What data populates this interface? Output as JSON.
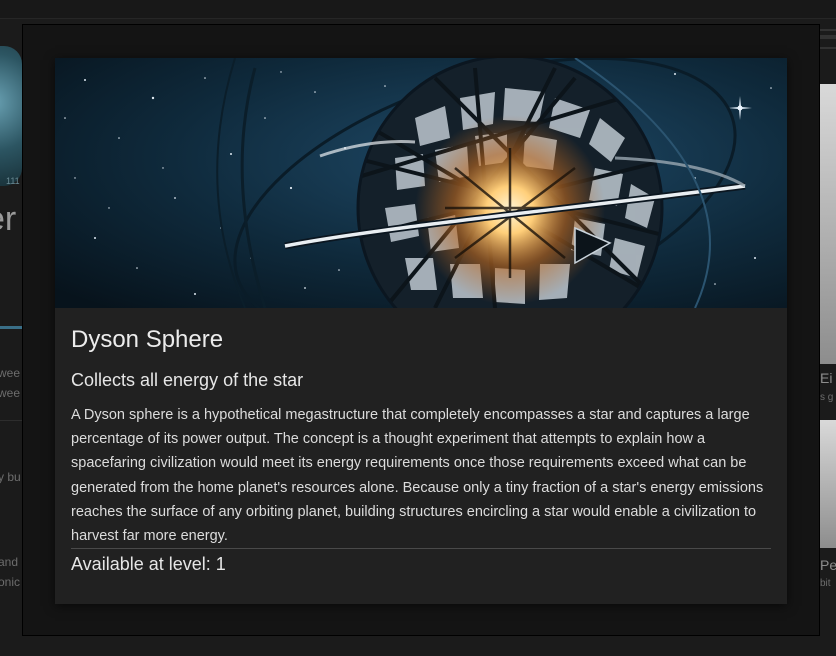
{
  "background": {
    "left_title_fragment": "er",
    "left_texts": [
      "wee",
      "wee",
      "y bu",
      "and",
      "onic"
    ],
    "right_texts": [
      "Ei",
      "s g",
      "Pe",
      "bit"
    ],
    "thumb_caption": "111"
  },
  "modal": {
    "image_subject": "dyson-sphere-illustration",
    "title": "Dyson Sphere",
    "subtitle": "Collects all energy of the star",
    "description": "A Dyson sphere is a hypothetical megastructure that completely encompasses a star and captures a large percentage of its power output. The concept is a thought experiment that attempts to explain how a spacefaring civilization would meet its energy requirements once those requirements exceed what can be generated from the home planet's resources alone. Because only a tiny fraction of a star's energy emissions reaches the surface of any orbiting planet, building structures encircling a star would enable a civilization to harvest far more energy.",
    "availability": "Available at level: 1"
  },
  "colors": {
    "backdrop": "#141414",
    "card": "#212121",
    "title_text": "#ececec",
    "body_text": "#dcdcdc",
    "space": "#0f2a3c",
    "glow": "#ffb15a"
  }
}
